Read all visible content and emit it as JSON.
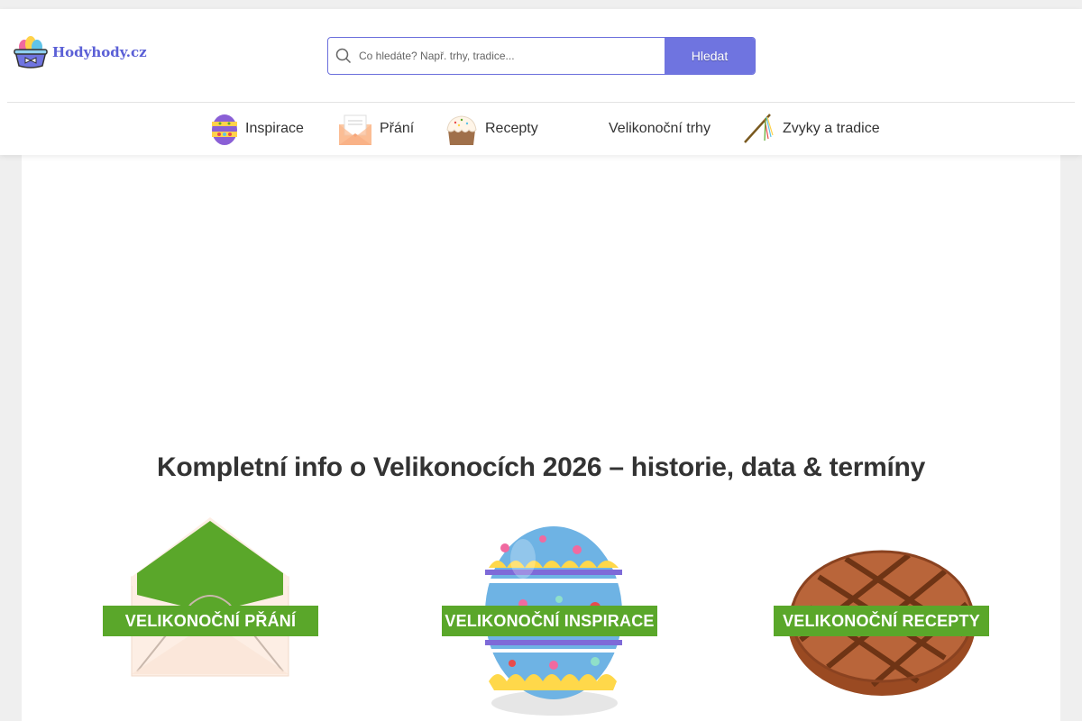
{
  "header": {
    "logo_text": "Hodyhody.cz",
    "search": {
      "placeholder": "Co hledáte? Např. trhy, tradice...",
      "button_label": "Hledat"
    }
  },
  "nav": {
    "items": [
      {
        "label": "Inspirace",
        "icon": "painted-egg-icon"
      },
      {
        "label": "Přání",
        "icon": "envelope-icon"
      },
      {
        "label": "Recepty",
        "icon": "cake-icon"
      },
      {
        "label": "Velikonoční trhy",
        "icon": ""
      },
      {
        "label": "Zvyky a tradice",
        "icon": "whip-icon"
      }
    ]
  },
  "main": {
    "headline": "Kompletní info o Velikonocích 2026 – historie, data & termíny",
    "cards": [
      {
        "label": "VELIKONOČNÍ PŘÁNÍ",
        "icon": "envelope-illustration"
      },
      {
        "label": "VELIKONOČNÍ INSPIRACE",
        "icon": "painted-egg-illustration"
      },
      {
        "label": "VELIKONOČNÍ RECEPTY",
        "icon": "bread-illustration"
      }
    ]
  },
  "colors": {
    "brand": "#5a5fd6",
    "search_button": "#6f74e0",
    "label_green": "#5aa72a",
    "page_background": "#efefef"
  }
}
